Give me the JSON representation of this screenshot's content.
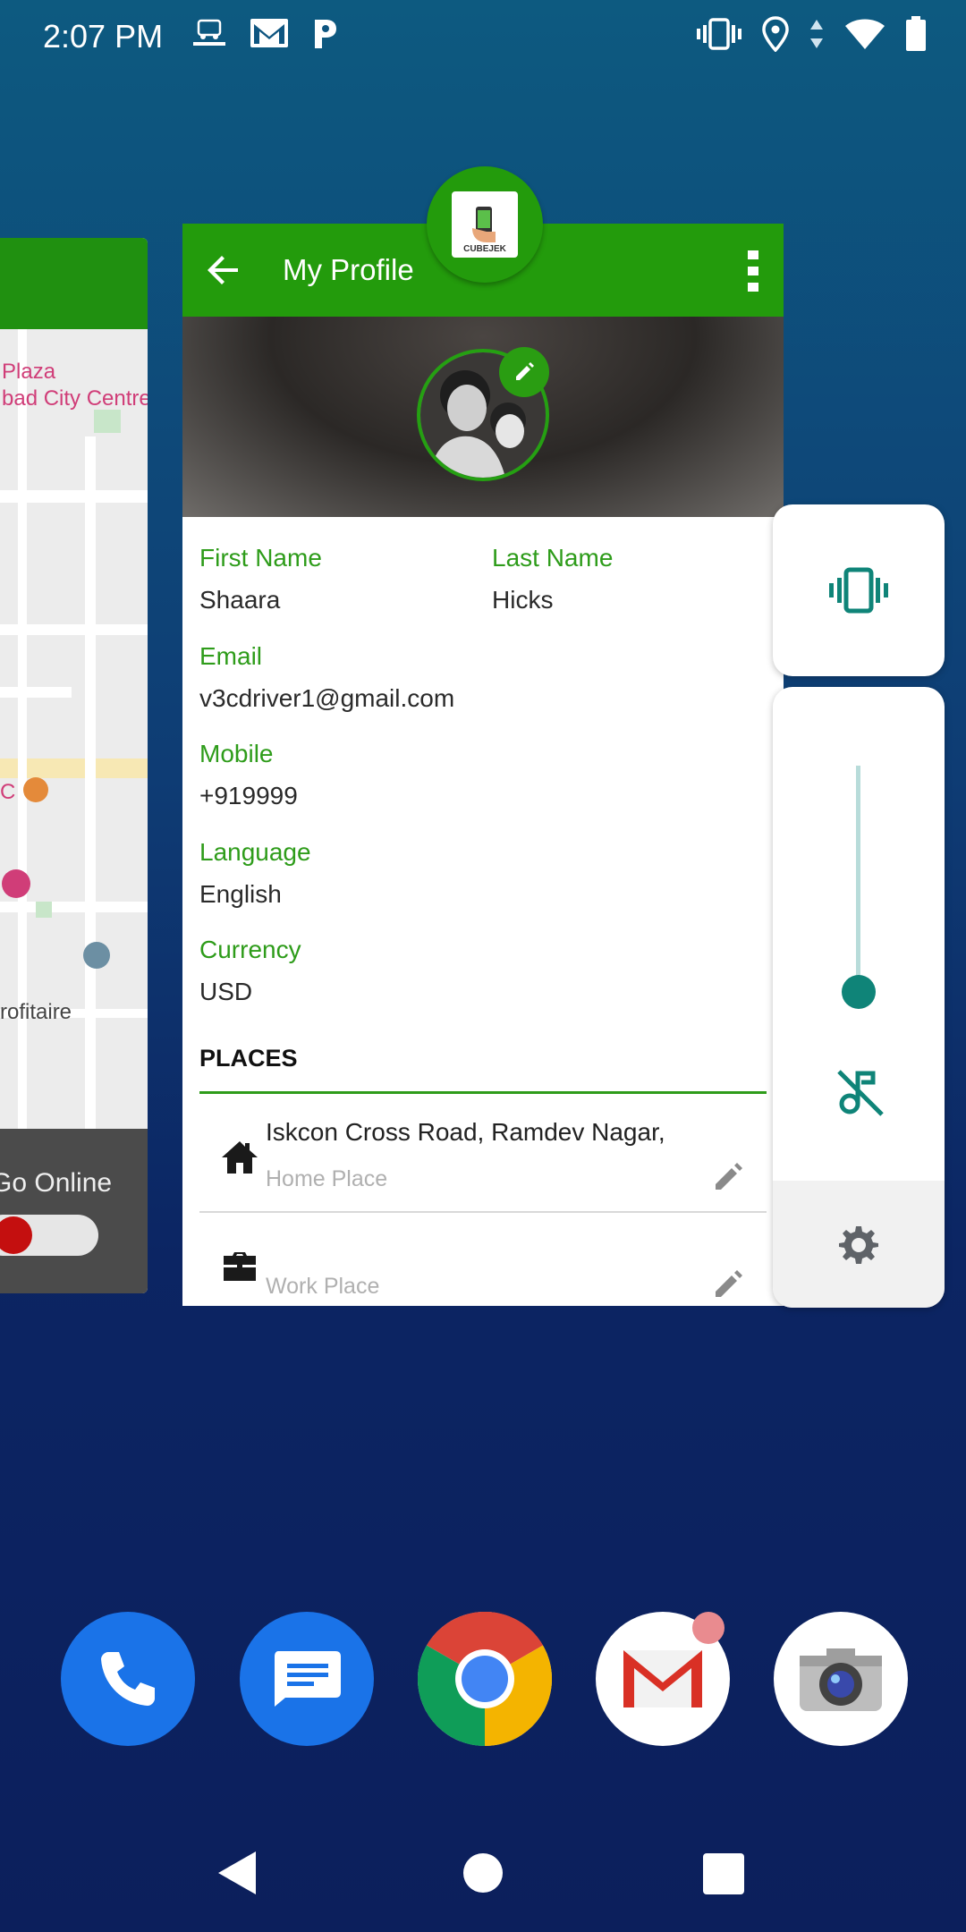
{
  "status_bar": {
    "time": "2:07 PM",
    "left_icons": [
      "driver-app-icon",
      "gmail-icon",
      "parking-icon"
    ],
    "right_icons": [
      "vibrate-icon",
      "location-icon",
      "data-arrows-icon",
      "wifi-icon",
      "battery-icon"
    ]
  },
  "left_card": {
    "map_labels": [
      "Plaza",
      "bad City Centre",
      "C",
      "rofitaire"
    ],
    "online_label": "Go Online"
  },
  "profile_card": {
    "app_icon_label": "CUBEJEK",
    "title": "My Profile",
    "fields": {
      "first_name_label": "First Name",
      "first_name_value": "Shaara",
      "last_name_label": "Last Name",
      "last_name_value": "Hicks",
      "email_label": "Email",
      "email_value": "v3cdriver1@gmail.com",
      "mobile_label": "Mobile",
      "mobile_value": "+919999",
      "language_label": "Language",
      "language_value": "English",
      "currency_label": "Currency",
      "currency_value": "USD"
    },
    "places_title": "PLACES",
    "places": [
      {
        "address": "Iskcon Cross Road, Ramdev Nagar,",
        "hint": "Home Place",
        "icon": "home-icon"
      },
      {
        "address": "",
        "hint": "Work Place",
        "icon": "briefcase-icon"
      }
    ]
  },
  "volume_panel": {
    "ringer_mode_icon": "vibrate-icon",
    "media_muted_icon": "music-off-icon",
    "settings_icon": "gear-icon",
    "level": 0.0
  },
  "dock": [
    "phone-app-icon",
    "messages-app-icon",
    "chrome-app-icon",
    "gmail-app-icon",
    "camera-app-icon"
  ],
  "colors": {
    "primary_green": "#239b0c",
    "label_green": "#2e9c1a",
    "accent_teal": "#0f8478"
  }
}
